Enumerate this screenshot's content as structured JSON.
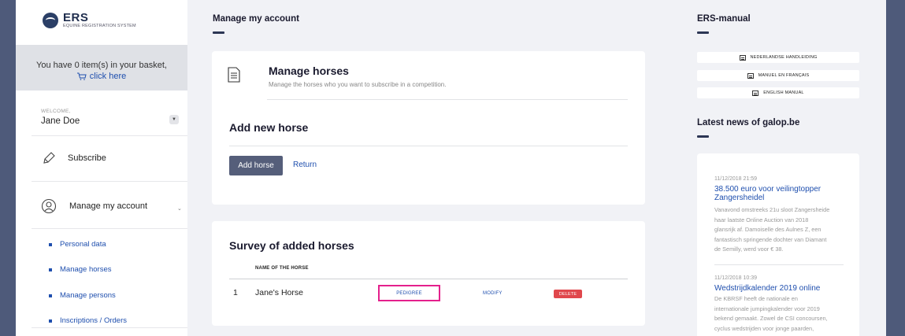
{
  "brand": {
    "name": "ERS",
    "subtitle": "EQUINE REGISTRATION SYSTEM"
  },
  "basket": {
    "text": "You have 0 item(s) in your basket,",
    "link": "click here"
  },
  "user": {
    "welcome": "WELCOME,",
    "name": "Jane Doe"
  },
  "nav": {
    "subscribe": "Subscribe",
    "manage_account": "Manage my account",
    "sub_items": [
      "Personal data",
      "Manage horses",
      "Manage persons",
      "Inscriptions / Orders"
    ]
  },
  "main": {
    "title": "Manage my account",
    "manage_horses": {
      "heading": "Manage horses",
      "subtitle": "Manage the horses who you want to subscribe in a competition."
    },
    "add_new": {
      "heading": "Add new horse",
      "add_button": "Add horse",
      "return_link": "Return"
    },
    "survey": {
      "heading": "Survey of added horses",
      "column_name": "NAME OF THE HORSE",
      "rows": [
        {
          "num": "1",
          "name": "Jane's Horse",
          "pedigree": "PEDIGREE",
          "modify": "MODIFY",
          "delete": "DELETE"
        }
      ]
    }
  },
  "right": {
    "manual_title": "ERS-manual",
    "manuals": [
      "NEDERLANDSE HANDLEIDING",
      "MANUEL EN FRANÇAIS",
      "ENGLISH MANUAL"
    ],
    "news_title": "Latest news of galop.be",
    "news": [
      {
        "date": "11/12/2018 21:59",
        "title": "38.500 euro voor veilingtopper Zangersheidel",
        "lines": [
          "Vanavond omstreeks 21u sloot Zangersheide",
          "haar laatste Online Auction van 2018",
          "glansrijk af. Damoiselle des Aulnes Z, een",
          "fantastisch springende dochter van Diamant",
          "de Semilly, werd voor € 38."
        ]
      },
      {
        "date": "11/12/2018 10:39",
        "title": "Wedstrijdkalender 2019 online",
        "lines": [
          "De KBRSF heeft de nationale en",
          "internationale jumpingkalender voor 2019",
          "bekend gemaakt.  Zowel de CSI concoursen,",
          "cyclus wedstrijden voor jonge paarden,"
        ]
      }
    ]
  },
  "colors": {
    "accent": "#1f4fae",
    "highlight": "#e4208c",
    "danger": "#e0474c",
    "button": "#555e7a",
    "frame": "#4e5a7a"
  }
}
